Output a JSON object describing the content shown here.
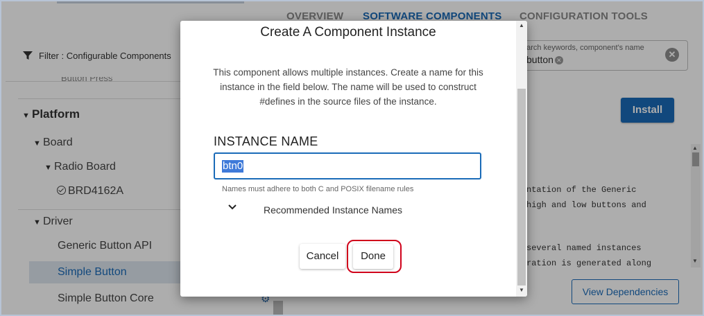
{
  "nav": {
    "tabs": [
      {
        "label": "OVERVIEW"
      },
      {
        "label": "SOFTWARE COMPONENTS"
      },
      {
        "label": "CONFIGURATION TOOLS"
      }
    ]
  },
  "filter": {
    "label": "Filter :  Configurable Components",
    "cut_text": "Button Press"
  },
  "tree": {
    "platform": "Platform",
    "board": "Board",
    "radio_board": "Radio Board",
    "brd": "BRD4162A",
    "driver": "Driver",
    "generic_button_api": "Generic Button API",
    "simple_button": "Simple Button",
    "simple_button_core": "Simple Button Core"
  },
  "search": {
    "hint": "earch keywords, component's name",
    "chip": "button"
  },
  "right": {
    "install_label": "Install",
    "view_dependencies_label": "View Dependencies",
    "code_lines": [
      "ntation of the Generic",
      " high and low buttons and",
      "",
      " several named instances",
      "ration is generated along"
    ]
  },
  "modal": {
    "title": "Create A Component Instance",
    "description": "This component allows multiple instances. Create a name for this instance in the field below. The name will be used to construct #defines in the source files of the instance.",
    "instance_label": "INSTANCE NAME",
    "instance_value": "btn0",
    "hint": "Names must adhere to both C and POSIX filename rules",
    "recommended_label": "Recommended Instance Names",
    "cancel_label": "Cancel",
    "done_label": "Done"
  },
  "colors": {
    "accent": "#1a6bb8",
    "highlight_ring": "#d0021b"
  }
}
